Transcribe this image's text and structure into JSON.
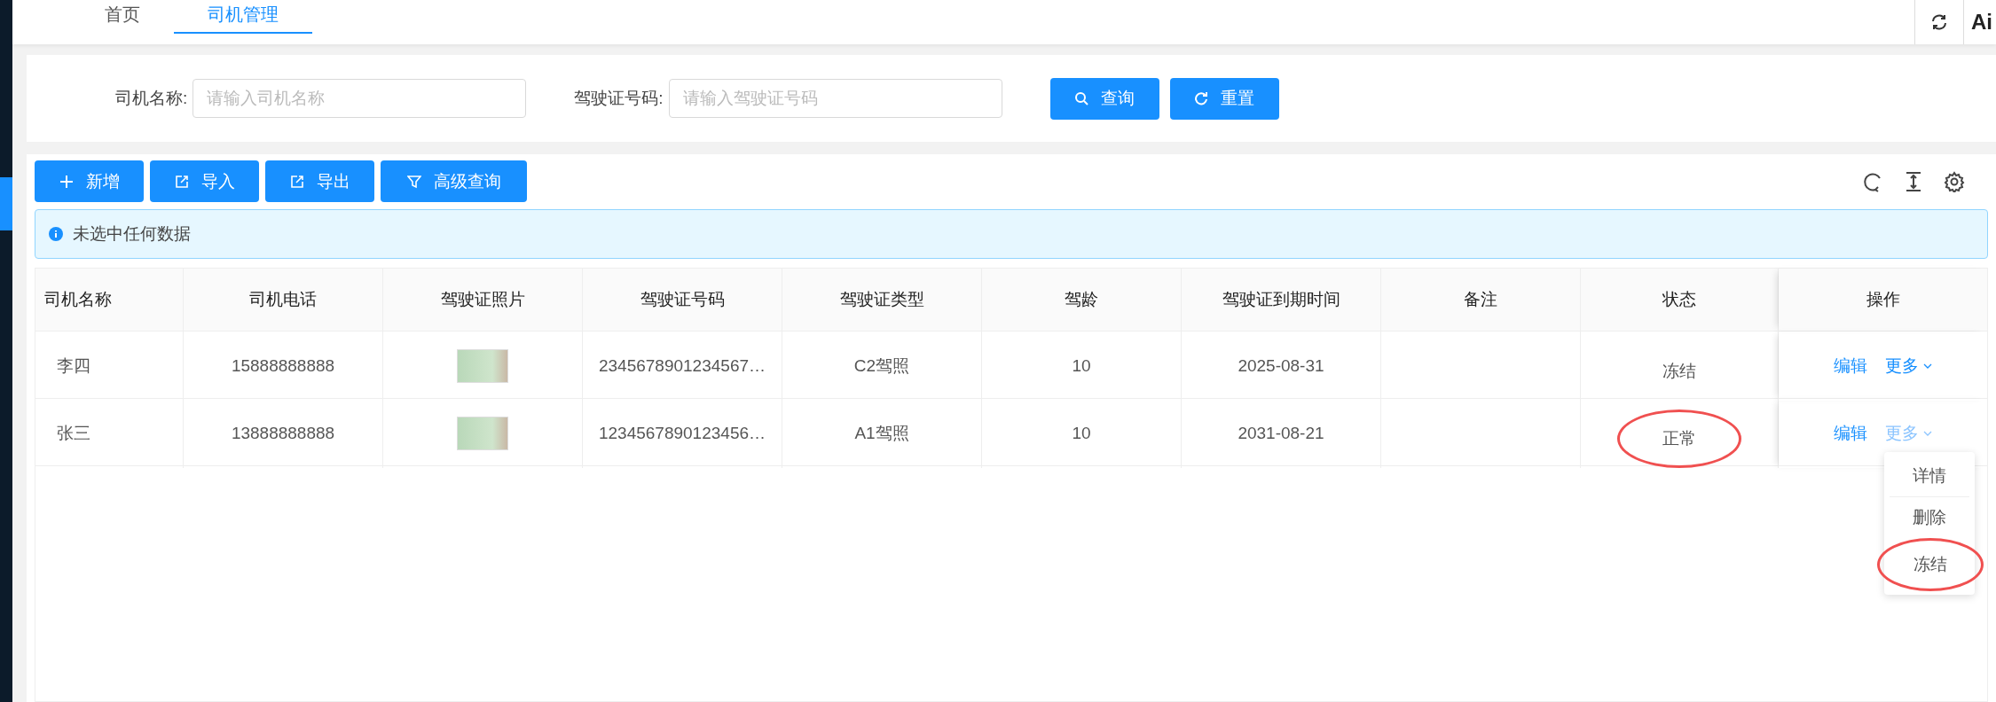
{
  "nav": {
    "tabs": [
      {
        "label": "首页",
        "selected": false
      },
      {
        "label": "司机管理",
        "selected": true
      }
    ],
    "right_label": "Ai"
  },
  "search": {
    "fields": [
      {
        "label": "司机名称:",
        "placeholder": "请输入司机名称"
      },
      {
        "label": "驾驶证号码:",
        "placeholder": "请输入驾驶证号码"
      }
    ],
    "buttons": [
      {
        "kind": "search",
        "label": "查询"
      },
      {
        "kind": "reset",
        "label": "重置"
      }
    ]
  },
  "toolbar": {
    "buttons": [
      {
        "kind": "add",
        "label": "新增"
      },
      {
        "kind": "import",
        "label": "导入"
      },
      {
        "kind": "export",
        "label": "导出"
      },
      {
        "kind": "filter",
        "label": "高级查询"
      }
    ]
  },
  "alert": "未选中任何数据",
  "table": {
    "columns": [
      "司机名称",
      "司机电话",
      "驾驶证照片",
      "驾驶证号码",
      "驾驶证类型",
      "驾龄",
      "驾驶证到期时间",
      "备注",
      "状态",
      "操作"
    ],
    "rows": [
      {
        "name": "李四",
        "phone": "15888888888",
        "license_no": "2345678901234567…",
        "license_type": "C2驾照",
        "years": "10",
        "expiry": "2025-08-31",
        "status": "冻结",
        "status_circled": false,
        "edit": "编辑",
        "more": "更多",
        "menu_open": false
      },
      {
        "name": "张三",
        "phone": "13888888888",
        "license_no": "1234567890123456…",
        "license_type": "A1驾照",
        "years": "10",
        "expiry": "2031-08-21",
        "status": "正常",
        "status_circled": true,
        "edit": "编辑",
        "more": "更多",
        "menu_open": true
      }
    ]
  },
  "menu": {
    "items": [
      {
        "label": "详情",
        "circled": false
      },
      {
        "label": "删除",
        "circled": false
      },
      {
        "label": "冻结",
        "circled": true
      }
    ]
  }
}
